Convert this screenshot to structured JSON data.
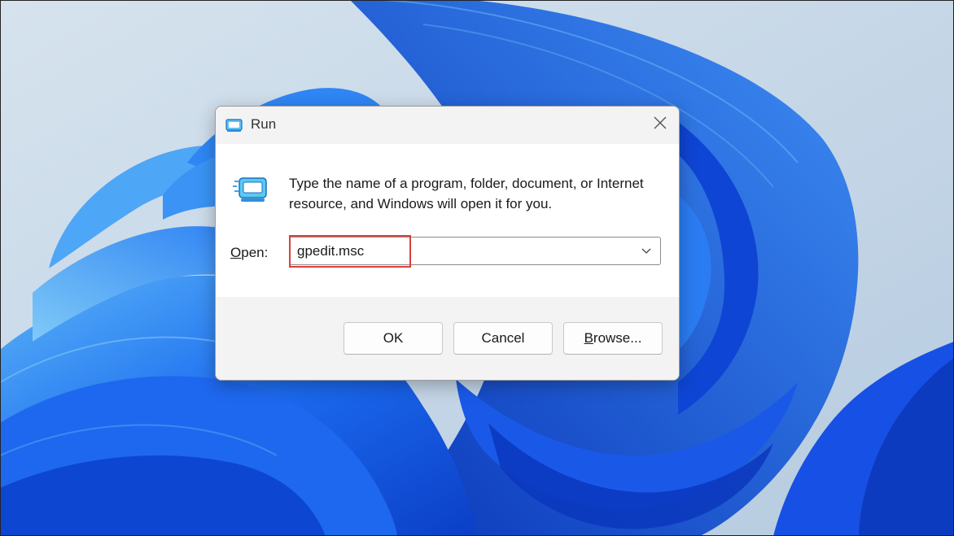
{
  "colors": {
    "wallpaper_sky": "#c4d6e6",
    "wallpaper_bloom": "#1a5ff0",
    "highlight_box": "#d9403a"
  },
  "dialog": {
    "title": "Run",
    "title_icon": "run-icon",
    "close_icon": "close-icon",
    "description": "Type the name of a program, folder, document, or Internet resource, and Windows will open it for you.",
    "open_label_underlined": "O",
    "open_label_rest": "pen:",
    "open_value": "gpedit.msc",
    "dropdown_icon": "chevron-down-icon",
    "buttons": {
      "ok": "OK",
      "cancel": "Cancel",
      "browse_underlined": "B",
      "browse_rest": "rowse..."
    }
  }
}
